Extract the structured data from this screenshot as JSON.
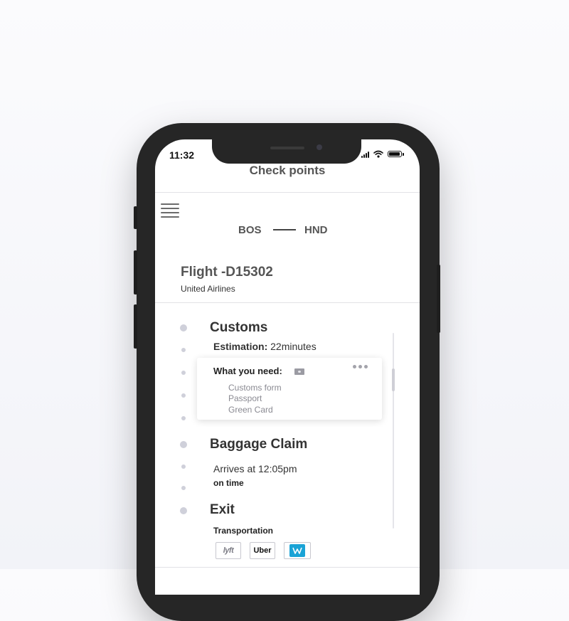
{
  "status_bar": {
    "time": "11:32"
  },
  "header": {
    "title": "Check points"
  },
  "route": {
    "origin": "BOS",
    "destination": "HND"
  },
  "flight": {
    "number": "Flight -D15302",
    "airline": "United Airlines"
  },
  "checkpoints": {
    "customs": {
      "title": "Customs",
      "estimation_label": "Estimation:",
      "estimation_value": " 22minutes",
      "need_label": "What you need:",
      "items": [
        "Customs form",
        "Passport",
        "Green Card"
      ]
    },
    "baggage": {
      "title": "Baggage Claim",
      "arrives": "Arrives at 12:05pm",
      "status": "on time"
    },
    "exit": {
      "title": "Exit",
      "transport_label": "Transportation",
      "apps": [
        "lyft",
        "Uber"
      ]
    }
  },
  "icons": {
    "menu": "hamburger-menu-icon",
    "more": "more-dots-icon",
    "document": "document-icon",
    "signal": "signal-icon",
    "wifi": "wifi-icon",
    "battery": "battery-icon"
  },
  "colors": {
    "timeline_dot": "#cfd0da",
    "third_app": "#1aa3d6"
  }
}
